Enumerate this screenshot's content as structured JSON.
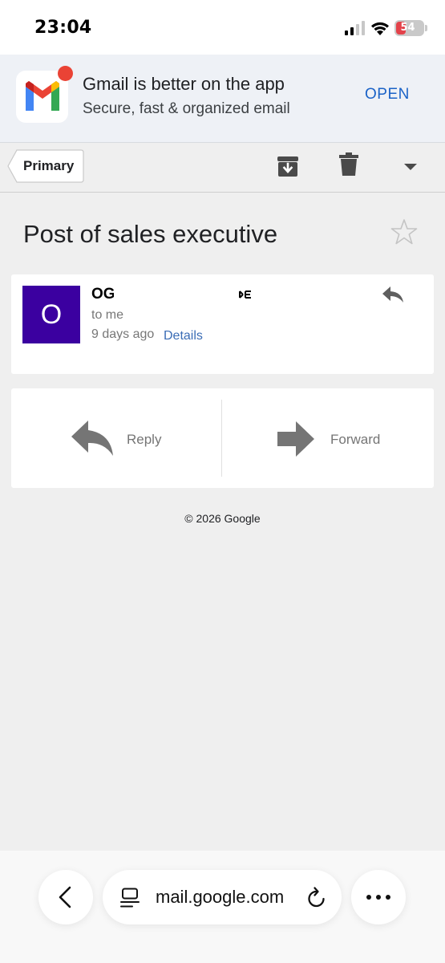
{
  "status_bar": {
    "time": "23:04",
    "battery": "54",
    "icons": [
      "signal-icon",
      "wifi-icon",
      "battery-icon"
    ]
  },
  "app_banner": {
    "title": "Gmail is better on the app",
    "subtitle": "Secure, fast & organized email",
    "open_label": "OPEN",
    "logo": "gmail-logo-icon",
    "colors": {
      "open": "#1a62c7",
      "badge": "#ea4335"
    }
  },
  "toolbar": {
    "primary_label": "Primary",
    "icons": [
      "archive-icon",
      "trash-icon",
      "dropdown-icon"
    ]
  },
  "email": {
    "subject": "Post of sales executive",
    "starred": false,
    "sender_visible": "OG",
    "sender_tail": "E",
    "avatar_letter": "O",
    "avatar_color": "#3b00a0",
    "recipient": "to me",
    "time_ago": "9 days ago",
    "details_label": "Details"
  },
  "actions": {
    "reply_label": "Reply",
    "forward_label": "Forward"
  },
  "footer": {
    "copyright": "© 2026 Google"
  },
  "browser": {
    "url": "mail.google.com",
    "icons": [
      "back-icon",
      "tabs-icon",
      "reload-icon",
      "more-icon"
    ]
  }
}
